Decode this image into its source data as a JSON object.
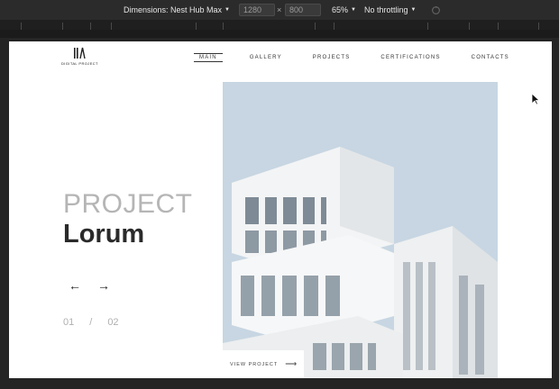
{
  "toolbar": {
    "dimensions_label": "Dimensions: Nest Hub Max",
    "width_value": "1280",
    "times": "×",
    "height_value": "800",
    "zoom": "65%",
    "throttling": "No throttling"
  },
  "site": {
    "logo_text": "DIGITAL PROJECT",
    "nav": [
      "MAIN",
      "GALLERY",
      "PROJECTS",
      "CERTIFICATIONS",
      "CONTACTS"
    ],
    "active_nav": "MAIN",
    "title_light": "PROJECT",
    "title_bold": "Lorum",
    "prev_arrow": "←",
    "next_arrow": "→",
    "pager_current": "01",
    "pager_sep": "/",
    "pager_total": "02",
    "view_label": "VIEW PROJECT",
    "view_arrow": "⟶"
  },
  "colors": {
    "sky": "#c7d6e2",
    "building": "#f0f0f0",
    "text_dark": "#2a2a2a",
    "text_light": "#b5b5b5"
  }
}
